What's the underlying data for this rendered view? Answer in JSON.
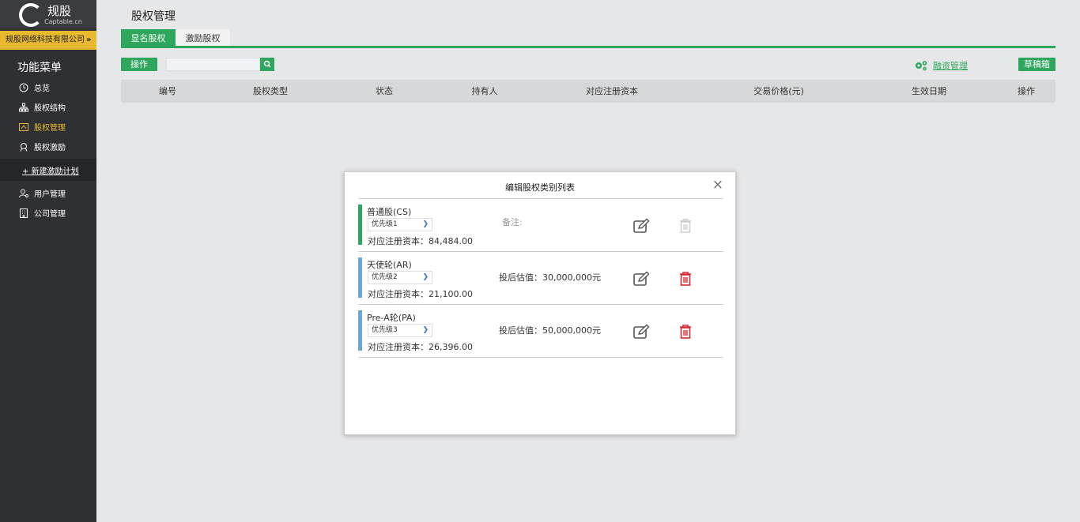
{
  "sidebar": {
    "logo_text": "规股",
    "logo_sub": "Captable.cn",
    "company_name": "规股网络科技有限公司",
    "company_arrow": "»",
    "menu_title": "功能菜单",
    "items": [
      {
        "label": "总览",
        "icon": "clock-icon",
        "active": false
      },
      {
        "label": "股权结构",
        "icon": "org-chart-icon",
        "active": false
      },
      {
        "label": "股权管理",
        "icon": "equity-icon",
        "active": true
      },
      {
        "label": "股权激励",
        "icon": "award-icon",
        "active": false
      },
      {
        "label": "+ 新建激励计划",
        "icon": "",
        "active": false
      },
      {
        "label": "用户管理",
        "icon": "user-settings-icon",
        "active": false
      },
      {
        "label": "公司管理",
        "icon": "building-icon",
        "active": false
      }
    ],
    "active_color": "#e8b92e"
  },
  "header": {
    "title": "股权管理"
  },
  "tabs": [
    {
      "label": "显名股权",
      "active": true
    },
    {
      "label": "激励股权",
      "active": false
    }
  ],
  "toolbar": {
    "action_label": "操作",
    "search_placeholder": "",
    "finance_label": "融资管理",
    "drafts_label": "草稿箱"
  },
  "table": {
    "columns": [
      "编号",
      "股权类型",
      "状态",
      "持有人",
      "对应注册资本",
      "交易价格(元)",
      "生效日期",
      "操作"
    ]
  },
  "modal": {
    "title": "编辑股权类别列表",
    "close": "×",
    "rows": [
      {
        "name": "普通股(CS)",
        "priority": "优先级1",
        "capital": "对应注册资本：84,484.00",
        "note": "备注:",
        "valuation": "",
        "bar_color": "#2fa65d",
        "deletable": false
      },
      {
        "name": "天使轮(AR)",
        "priority": "优先级2",
        "capital": "对应注册资本：21,100.00",
        "note": "",
        "valuation": "投后估值：30,000,000元",
        "bar_color": "#6aa7d8",
        "deletable": true
      },
      {
        "name": "Pre-A轮(PA)",
        "priority": "优先级3",
        "capital": "对应注册资本：26,396.00",
        "note": "",
        "valuation": "投后估值：50,000,000元",
        "bar_color": "#6aa7d8",
        "deletable": true
      }
    ]
  },
  "colors": {
    "brand_green": "#2fa65d",
    "delete_red": "#d9292f",
    "sidebar_bg": "#2f3033"
  }
}
